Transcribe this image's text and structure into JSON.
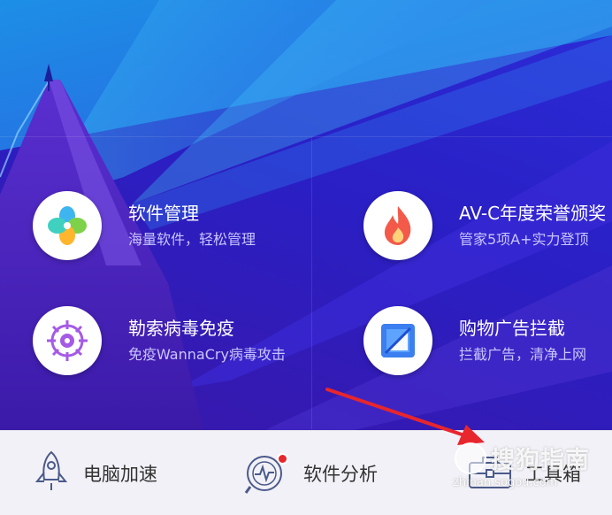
{
  "features": [
    {
      "title": "软件管理",
      "subtitle": "海量软件，轻松管理",
      "icon": "clover-icon"
    },
    {
      "title": "AV-C年度荣誉颁奖",
      "subtitle": "管家5项A+实力登顶",
      "icon": "flame-icon"
    },
    {
      "title": "勒索病毒免疫",
      "subtitle": "免疫WannaCry病毒攻击",
      "icon": "shield-target-icon"
    },
    {
      "title": "购物广告拦截",
      "subtitle": "拦截广告，清净上网",
      "icon": "ad-block-icon"
    }
  ],
  "toolbar": [
    {
      "label": "电脑加速",
      "icon": "rocket-icon"
    },
    {
      "label": "软件分析",
      "icon": "analysis-icon",
      "has_badge": true
    },
    {
      "label": "工具箱",
      "icon": "toolbox-icon"
    }
  ],
  "watermark": {
    "text": "搜狗指南",
    "url": "zhinan.sogou.com"
  },
  "colors": {
    "accent_red": "#e8262d",
    "hero_blue": "#2a1fc4",
    "bottom_bg": "#f2f1f7"
  }
}
